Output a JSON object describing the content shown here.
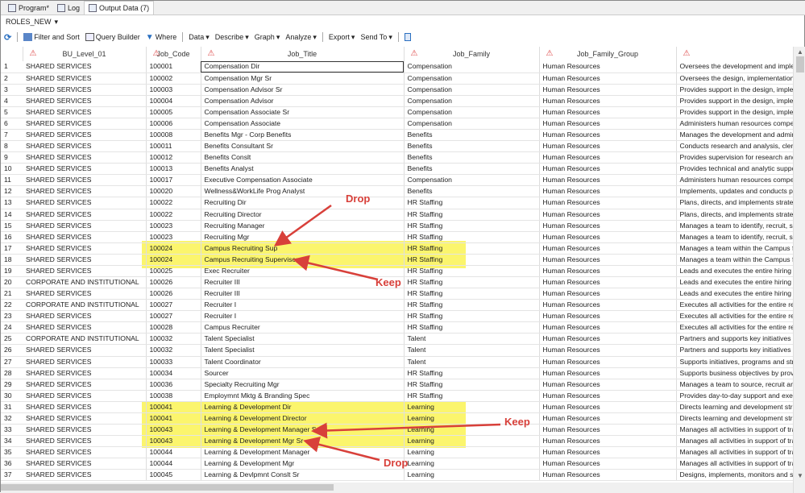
{
  "tabs": [
    {
      "label": "Program*",
      "icon": "program-icon"
    },
    {
      "label": "Log",
      "icon": "log-icon"
    },
    {
      "label": "Output Data (7)",
      "icon": "output-data-icon"
    }
  ],
  "dataset": {
    "name": "ROLES_NEW",
    "caret": "▾"
  },
  "toolbar": {
    "refresh": "refresh-icon",
    "filter_sort": "Filter and Sort",
    "query_builder": "Query Builder",
    "where": "Where",
    "data": "Data",
    "describe": "Describe",
    "graph": "Graph",
    "analyze": "Analyze",
    "export": "Export",
    "send_to": "Send To",
    "caret": "▾"
  },
  "columns": [
    "BU_Level_01",
    "Job_Code",
    "Job_Title",
    "Job_Family",
    "Job_Family_Group",
    ""
  ],
  "rows": [
    [
      "1",
      "SHARED SERVICES",
      "100001",
      "Compensation Dir",
      "Compensation",
      "Human Resources",
      "Oversees the development and implemer"
    ],
    [
      "2",
      "SHARED SERVICES",
      "100002",
      "Compensation Mgr Sr",
      "Compensation",
      "Human Resources",
      "Oversees the design, implementation, co"
    ],
    [
      "3",
      "SHARED SERVICES",
      "100003",
      "Compensation Advisor Sr",
      "Compensation",
      "Human Resources",
      "Provides support in the design, implemer"
    ],
    [
      "4",
      "SHARED SERVICES",
      "100004",
      "Compensation Advisor",
      "Compensation",
      "Human Resources",
      "Provides support in the design, implemer"
    ],
    [
      "5",
      "SHARED SERVICES",
      "100005",
      "Compensation Associate Sr",
      "Compensation",
      "Human Resources",
      "Provides support in the design, implemer"
    ],
    [
      "6",
      "SHARED SERVICES",
      "100006",
      "Compensation Associate",
      "Compensation",
      "Human Resources",
      "Administers human resources compensa"
    ],
    [
      "7",
      "SHARED SERVICES",
      "100008",
      "Benefits Mgr - Corp Benefits",
      "Benefits",
      "Human Resources",
      "Manages the development and administra"
    ],
    [
      "8",
      "SHARED SERVICES",
      "100011",
      "Benefits Consultant Sr",
      "Benefits",
      "Human Resources",
      "Conducts research and analysis, clerical"
    ],
    [
      "9",
      "SHARED SERVICES",
      "100012",
      "Benefits Conslt",
      "Benefits",
      "Human Resources",
      "Provides supervision for research and ar"
    ],
    [
      "10",
      "SHARED SERVICES",
      "100013",
      "Benefits Analyst",
      "Benefits",
      "Human Resources",
      "Provides technical and analytic support a"
    ],
    [
      "11",
      "SHARED SERVICES",
      "100017",
      "Executive Compensation Associate",
      "Compensation",
      "Human Resources",
      "Administers human resources compensa"
    ],
    [
      "12",
      "SHARED SERVICES",
      "100020",
      "Wellness&WorkLife Prog Analyst",
      "Benefits",
      "Human Resources",
      "Implements, updates and conducts prese"
    ],
    [
      "13",
      "SHARED SERVICES",
      "100022",
      "Recruiting Dir",
      "HR Staffing",
      "Human Resources",
      "Plans, directs, and implements strategic"
    ],
    [
      "14",
      "SHARED SERVICES",
      "100022",
      "Recruiting Director",
      "HR Staffing",
      "Human Resources",
      "Plans, directs, and implements strategic"
    ],
    [
      "15",
      "SHARED SERVICES",
      "100023",
      "Recruiting Manager",
      "HR Staffing",
      "Human Resources",
      "Manages a team to identify, recruit, selec"
    ],
    [
      "16",
      "SHARED SERVICES",
      "100023",
      "Recruiting Mgr",
      "HR Staffing",
      "Human Resources",
      "Manages a team to identify, recruit, selec"
    ],
    [
      "17",
      "SHARED SERVICES",
      "100024",
      "Campus Recruiting Sup",
      "HR Staffing",
      "Human Resources",
      "Manages a team within the Campus funct"
    ],
    [
      "18",
      "SHARED SERVICES",
      "100024",
      "Campus Recruiting Supervisor",
      "HR Staffing",
      "Human Resources",
      "Manages a team within the Campus funct"
    ],
    [
      "19",
      "SHARED SERVICES",
      "100025",
      "Exec Recruiter",
      "HR Staffing",
      "Human Resources",
      "Leads and executes the entire hiring cycl"
    ],
    [
      "20",
      "CORPORATE AND INSTITUTIONAL",
      "100026",
      "Recruiter III",
      "HR Staffing",
      "Human Resources",
      "Leads and executes the entire hiring cycl"
    ],
    [
      "21",
      "SHARED SERVICES",
      "100026",
      "Recruiter III",
      "HR Staffing",
      "Human Resources",
      "Leads and executes the entire hiring cycl"
    ],
    [
      "22",
      "CORPORATE AND INSTITUTIONAL",
      "100027",
      "Recruiter I",
      "HR Staffing",
      "Human Resources",
      "Executes all activities for the entire recru"
    ],
    [
      "23",
      "SHARED SERVICES",
      "100027",
      "Recruiter I",
      "HR Staffing",
      "Human Resources",
      "Executes all activities for the entire recru"
    ],
    [
      "24",
      "SHARED SERVICES",
      "100028",
      "Campus Recruiter",
      "HR Staffing",
      "Human Resources",
      "Executes all activities for the entire recru"
    ],
    [
      "25",
      "CORPORATE AND INSTITUTIONAL",
      "100032",
      "Talent Specialist",
      "Talent",
      "Human Resources",
      "Partners and supports key initiatives thrc"
    ],
    [
      "26",
      "SHARED SERVICES",
      "100032",
      "Talent Specialist",
      "Talent",
      "Human Resources",
      "Partners and supports key initiatives thrc"
    ],
    [
      "27",
      "SHARED SERVICES",
      "100033",
      "Talent Coordinator",
      "Talent",
      "Human Resources",
      "Supports initiatives, programs and strate("
    ],
    [
      "28",
      "SHARED SERVICES",
      "100034",
      "Sourcer",
      "HR Staffing",
      "Human Resources",
      "Supports business objectives by providir"
    ],
    [
      "29",
      "SHARED SERVICES",
      "100036",
      "Specialty Recruiting Mgr",
      "HR Staffing",
      "Human Resources",
      "Manages a team to source, recruit and id"
    ],
    [
      "30",
      "SHARED SERVICES",
      "100038",
      "Employmnt Mktg & Branding Spec",
      "HR Staffing",
      "Human Resources",
      "Provides day-to-day support and executi"
    ],
    [
      "31",
      "SHARED SERVICES",
      "100041",
      "Learning & Development Dir",
      "Learning",
      "Human Resources",
      "Directs learning and development strateg"
    ],
    [
      "32",
      "SHARED SERVICES",
      "100041",
      "Learning & Development Director",
      "Learning",
      "Human Resources",
      "Directs learning and development strateg"
    ],
    [
      "33",
      "SHARED SERVICES",
      "100043",
      "Learning & Development Manager Sr",
      "Learning",
      "Human Resources",
      "Manages all activities in support of trainii"
    ],
    [
      "34",
      "SHARED SERVICES",
      "100043",
      "Learning & Development Mgr Sr",
      "Learning",
      "Human Resources",
      "Manages all activities in support of trainii"
    ],
    [
      "35",
      "SHARED SERVICES",
      "100044",
      "Learning & Development Manager",
      "Learning",
      "Human Resources",
      "Manages all activities in support of trainii"
    ],
    [
      "36",
      "SHARED SERVICES",
      "100044",
      "Learning & Development Mgr",
      "Learning",
      "Human Resources",
      "Manages all activities in support of trainii"
    ],
    [
      "37",
      "SHARED SERVICES",
      "100045",
      "Learning & Devlpmnt Conslt Sr",
      "Learning",
      "Human Resources",
      "Designs, implements, monitors and supp"
    ]
  ],
  "highlighted_rows": [
    17,
    18,
    31,
    32,
    33,
    34
  ],
  "annotations": [
    {
      "text": "Drop",
      "target_row": 17
    },
    {
      "text": "Keep",
      "target_row": 18
    },
    {
      "text": "Keep",
      "target_row": 33
    },
    {
      "text": "Drop",
      "target_row": 34
    }
  ],
  "colors": {
    "highlight": "#fbf56a",
    "annotation": "#d8403a",
    "warning": "#d44444"
  }
}
